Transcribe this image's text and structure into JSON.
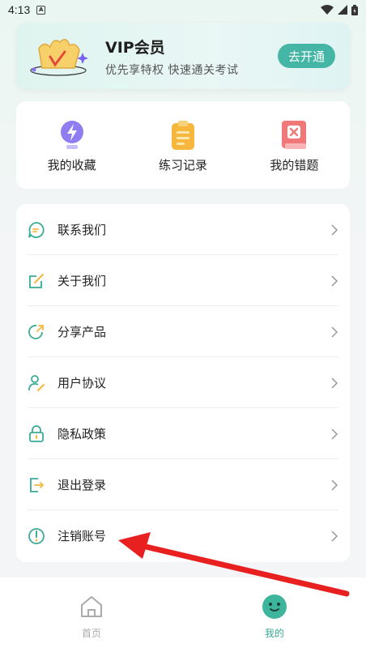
{
  "status_bar": {
    "time": "4:13",
    "notif": "A"
  },
  "vip": {
    "title": "VIP会员",
    "subtitle": "优先享特权 快速通关考试",
    "button": "去开通"
  },
  "quick": [
    {
      "label": "我的收藏",
      "icon": "lightning-bulb-icon"
    },
    {
      "label": "练习记录",
      "icon": "clipboard-icon"
    },
    {
      "label": "我的错题",
      "icon": "error-book-icon"
    }
  ],
  "menu": [
    {
      "label": "联系我们",
      "icon": "chat-icon"
    },
    {
      "label": "关于我们",
      "icon": "edit-note-icon"
    },
    {
      "label": "分享产品",
      "icon": "share-icon"
    },
    {
      "label": "用户协议",
      "icon": "user-agreement-icon"
    },
    {
      "label": "隐私政策",
      "icon": "lock-icon"
    },
    {
      "label": "退出登录",
      "icon": "logout-icon"
    },
    {
      "label": "注销账号",
      "icon": "power-icon"
    }
  ],
  "tabs": [
    {
      "label": "首页",
      "icon": "home-icon"
    },
    {
      "label": "我的",
      "icon": "smile-face-icon"
    }
  ],
  "colors": {
    "accent": "#45b6a6",
    "arrow": "#e82020"
  }
}
